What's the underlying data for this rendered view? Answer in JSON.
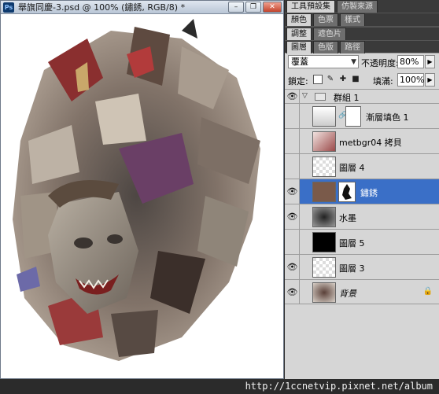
{
  "document": {
    "title": "舉旗同慶-3.psd @ 100% (鏽銹, RGB/8) *",
    "app_icon": "photoshop-icon",
    "window_buttons": [
      "minimize-icon",
      "restore-icon",
      "close-icon"
    ]
  },
  "panels": {
    "top_tabs": [
      {
        "label": "工具預設集",
        "active": true
      },
      {
        "label": "仿製來源",
        "active": false
      }
    ],
    "color_tabs": [
      {
        "label": "顏色",
        "active": true
      },
      {
        "label": "色票",
        "active": false
      },
      {
        "label": "樣式",
        "active": false
      }
    ],
    "adjust_tabs": [
      {
        "label": "調整",
        "active": true
      },
      {
        "label": "遮色片",
        "active": false
      }
    ],
    "layer_tabs": [
      {
        "label": "圖層",
        "active": true
      },
      {
        "label": "色版",
        "active": false
      },
      {
        "label": "路徑",
        "active": false
      }
    ]
  },
  "layers_panel": {
    "blend_mode": "覆蓋",
    "opacity_label": "不透明度:",
    "opacity": "80%",
    "lock_label": "鎖定:",
    "lock_icons": [
      "lock-transparency-icon",
      "lock-brush-icon",
      "lock-move-icon",
      "lock-all-icon"
    ],
    "fill_label": "填滿:",
    "fill": "100%"
  },
  "layers": [
    {
      "name": "群組 1",
      "kind": "group",
      "visible": true,
      "selected": false
    },
    {
      "name": "漸層填色 1",
      "kind": "adjustment",
      "visible": false,
      "selected": false
    },
    {
      "name": "metbgr04 拷貝",
      "kind": "pixel",
      "visible": false,
      "selected": false
    },
    {
      "name": "圖層 4",
      "kind": "pixel",
      "visible": false,
      "selected": false
    },
    {
      "name": "鏽銹",
      "kind": "pixel",
      "visible": true,
      "selected": true
    },
    {
      "name": "水墨",
      "kind": "pixel",
      "visible": true,
      "selected": false
    },
    {
      "name": "圖層 5",
      "kind": "pixel",
      "visible": false,
      "selected": false
    },
    {
      "name": "圖層 3",
      "kind": "pixel",
      "visible": true,
      "selected": false
    },
    {
      "name": "背景",
      "kind": "background",
      "visible": true,
      "selected": false
    }
  ],
  "footer": {
    "url": "http://1ccnetvip.pixnet.net/album"
  }
}
